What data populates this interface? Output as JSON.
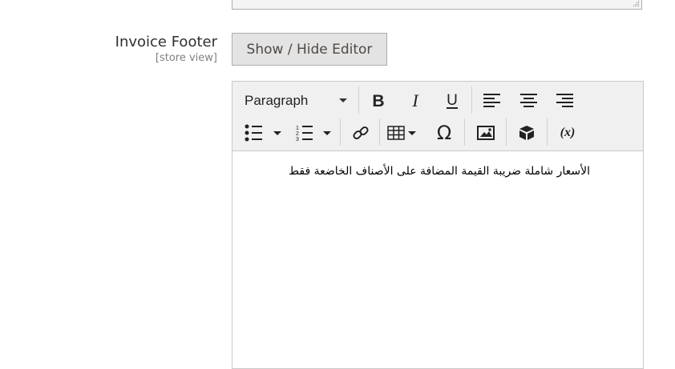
{
  "field": {
    "label": "Invoice Footer",
    "scope": "[store view]",
    "toggle_label": "Show / Hide Editor"
  },
  "toolbar": {
    "format_value": "Paragraph",
    "buttons": [
      "bold-icon",
      "italic-icon",
      "underline-icon",
      "align-left-icon",
      "align-center-icon",
      "align-right-icon",
      "bullet-list-icon",
      "numbered-list-icon",
      "link-icon",
      "table-icon",
      "special-character-icon",
      "insert-image-icon",
      "insert-widget-icon",
      "insert-variable-icon"
    ],
    "variable_label": "(x)",
    "omega": "Ω"
  },
  "editor": {
    "content": "الأسعار شاملة ضريبة القيمة المضافة على الأصناف الخاضعة فقط"
  }
}
